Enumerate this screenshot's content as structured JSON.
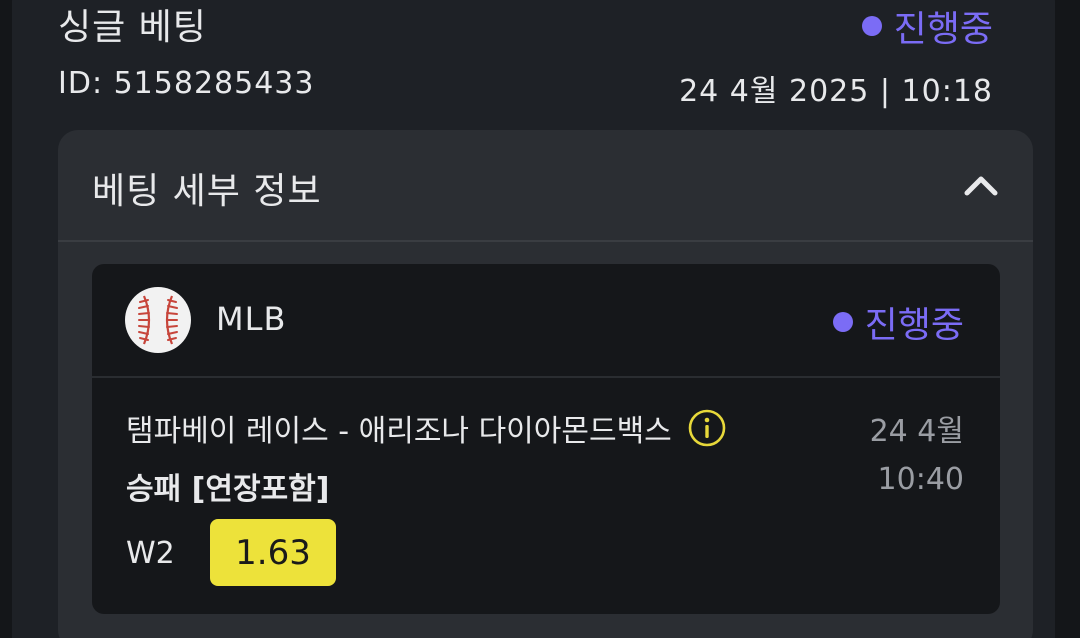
{
  "bet": {
    "title": "싱글 베팅",
    "status": "진행중",
    "id_label": "ID: 5158285433",
    "datetime": "24 4월 2025 | 10:18"
  },
  "details": {
    "title": "베팅 세부 정보"
  },
  "event": {
    "league": "MLB",
    "status": "진행중",
    "match": "탬파베이 레이스 - 애리조나 다이아몬드백스",
    "market": "승패 [연장포함]",
    "date": "24 4월",
    "time": "10:40",
    "pick": "W2",
    "odds": "1.63"
  },
  "icons": {
    "collapse": "chevron-up-icon",
    "sport": "baseball-icon",
    "info": "info-icon",
    "status": "status-dot-icon"
  },
  "colors": {
    "status": "#7b6cf5",
    "odds_background": "#ede23a",
    "info_icon": "#e7d83a"
  }
}
